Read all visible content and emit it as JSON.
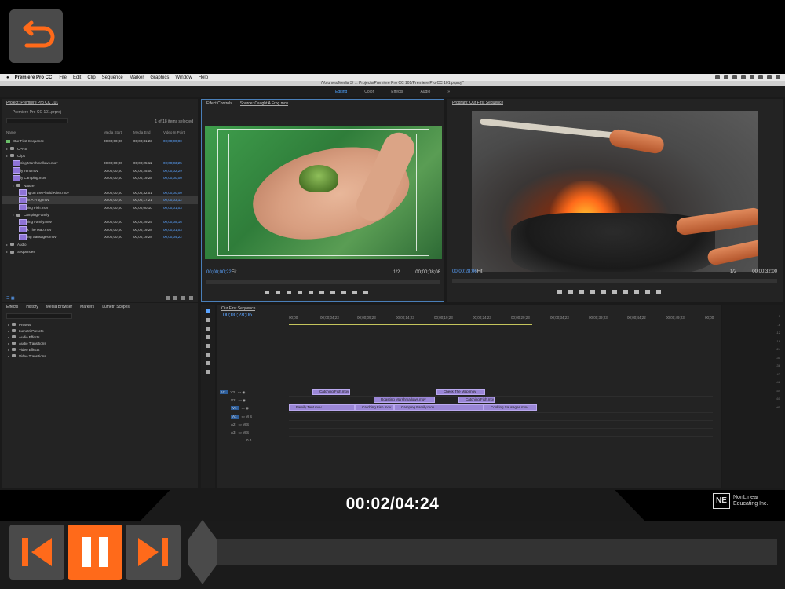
{
  "mac_menu": {
    "app_name": "Premiere Pro CC",
    "items": [
      "File",
      "Edit",
      "Clip",
      "Sequence",
      "Marker",
      "Graphics",
      "Window",
      "Help"
    ]
  },
  "window_title": "/Volumes/Media 3/ ... Projects/Premiere Pro CC 101/Premiere Pro CC 101.prproj *",
  "workspaces": {
    "items": [
      "Editing",
      "Color",
      "Effects",
      "Audio"
    ],
    "active": "Editing"
  },
  "project_panel": {
    "title": "Project: Premiere Pro CC 101",
    "file": "Premiere Pro CC 101.prproj",
    "item_count": "1 of 18 items selected",
    "columns": [
      "Name",
      "Media Start",
      "Media End",
      "Video In Point"
    ],
    "rows": [
      {
        "name": "Our First Sequence",
        "type": "seq",
        "indent": 0,
        "start": "00;00;00;00",
        "end": "00;00;31;23",
        "in": "00;00;00;00"
      },
      {
        "name": "CPHS",
        "type": "folder",
        "indent": 0,
        "start": "",
        "end": "",
        "in": ""
      },
      {
        "name": "Clips",
        "type": "folder",
        "indent": 0,
        "start": "",
        "end": "",
        "in": ""
      },
      {
        "name": "Roasting Marshmallows.mov",
        "type": "clip",
        "indent": 1,
        "start": "00;00;00;00",
        "end": "00;00;25;11",
        "in": "00;00;03;25"
      },
      {
        "name": "Family Tent.mov",
        "type": "clip",
        "indent": 1,
        "start": "00;00;00;00",
        "end": "00;00;25;00",
        "in": "00;00;02;29"
      },
      {
        "name": "Family Camping.mov",
        "type": "clip",
        "indent": 1,
        "start": "00;00;00;00",
        "end": "00;00;19;28",
        "in": "00;00;00;00"
      },
      {
        "name": "Nature",
        "type": "folder",
        "indent": 1,
        "start": "",
        "end": "",
        "in": ""
      },
      {
        "name": "Boating on the Placid River.mov",
        "type": "clip",
        "indent": 2,
        "start": "00;00;00;00",
        "end": "00;00;32;01",
        "in": "00;00;00;00"
      },
      {
        "name": "Caught A Frog.mov",
        "type": "clip",
        "indent": 2,
        "start": "00;00;00;00",
        "end": "00;00;17;21",
        "in": "00;00;03;12",
        "selected": true
      },
      {
        "name": "Catching Fish.mov",
        "type": "clip",
        "indent": 2,
        "start": "00;00;00;00",
        "end": "00;00;00;10",
        "in": "00;00;01;03"
      },
      {
        "name": "Camping Family",
        "type": "folder",
        "indent": 1,
        "start": "",
        "end": "",
        "in": ""
      },
      {
        "name": "Camping Family.mov",
        "type": "clip",
        "indent": 2,
        "start": "00;00;00;00",
        "end": "00;00;29;25",
        "in": "00;00;05;16"
      },
      {
        "name": "Check The Map.mov",
        "type": "clip",
        "indent": 2,
        "start": "00;00;00;00",
        "end": "00;00;19;28",
        "in": "00;00;01;03"
      },
      {
        "name": "Cooking Sausages.mov",
        "type": "clip",
        "indent": 2,
        "start": "00;00;00;00",
        "end": "00;00;19;28",
        "in": "00;00;04;22"
      },
      {
        "name": "Audio",
        "type": "folder",
        "indent": 0,
        "start": "",
        "end": "",
        "in": ""
      },
      {
        "name": "Sequences",
        "type": "folder",
        "indent": 0,
        "start": "",
        "end": "",
        "in": ""
      }
    ]
  },
  "effects_panel": {
    "tabs": [
      "Effects",
      "History",
      "Media Browser",
      "Markers",
      "Lumetri Scopes"
    ],
    "items": [
      "Presets",
      "Lumetri Presets",
      "Audio Effects",
      "Audio Transitions",
      "Video Effects",
      "Video Transitions"
    ]
  },
  "source_monitor": {
    "tabs": [
      "Effect Controls",
      "Source: Caught A Frog.mov"
    ],
    "timecode": "00;00;00;22",
    "fit": "Fit",
    "scale": "1/2",
    "duration": "00;00;08;08"
  },
  "program_monitor": {
    "title": "Program: Our First Sequence",
    "timecode": "00;00;28;06",
    "fit": "Fit",
    "scale": "1/2",
    "duration": "00;00;32;00"
  },
  "timeline": {
    "title": "Our First Sequence",
    "timecode": "00;00;28;06",
    "ruler": [
      "00;00",
      "00;00;04;23",
      "00;00;09;23",
      "00;00;14;23",
      "00;00;19;23",
      "00;00;24;23",
      "00;00;29;23",
      "00;00;34;23",
      "00;00;39;23",
      "00;00;44;22",
      "00;00;49;23",
      "00;00"
    ],
    "tracks": [
      "V3",
      "V2",
      "V1",
      "A1",
      "A2",
      "A3"
    ],
    "master_value": "0.0",
    "clips": {
      "v3": [
        "Catching Fish.mov",
        "Check The Map.mov"
      ],
      "v2": [
        "Roasting Marshmallows.mov",
        "Catching Fish.mov"
      ],
      "v1": [
        "Family Tent.mov",
        "Catching Fish.mov",
        "Camping Family.mov",
        "Cooking Sausages.mov"
      ]
    }
  },
  "meter_scale": [
    "0",
    "-6",
    "-12",
    "-18",
    "-24",
    "-30",
    "-36",
    "-42",
    "-48",
    "-54",
    "-60",
    "dB"
  ],
  "player": {
    "time": "00:02/04:24"
  },
  "brand": {
    "logo": "NE",
    "line1": "NonLinear",
    "line2": "Educating Inc."
  }
}
